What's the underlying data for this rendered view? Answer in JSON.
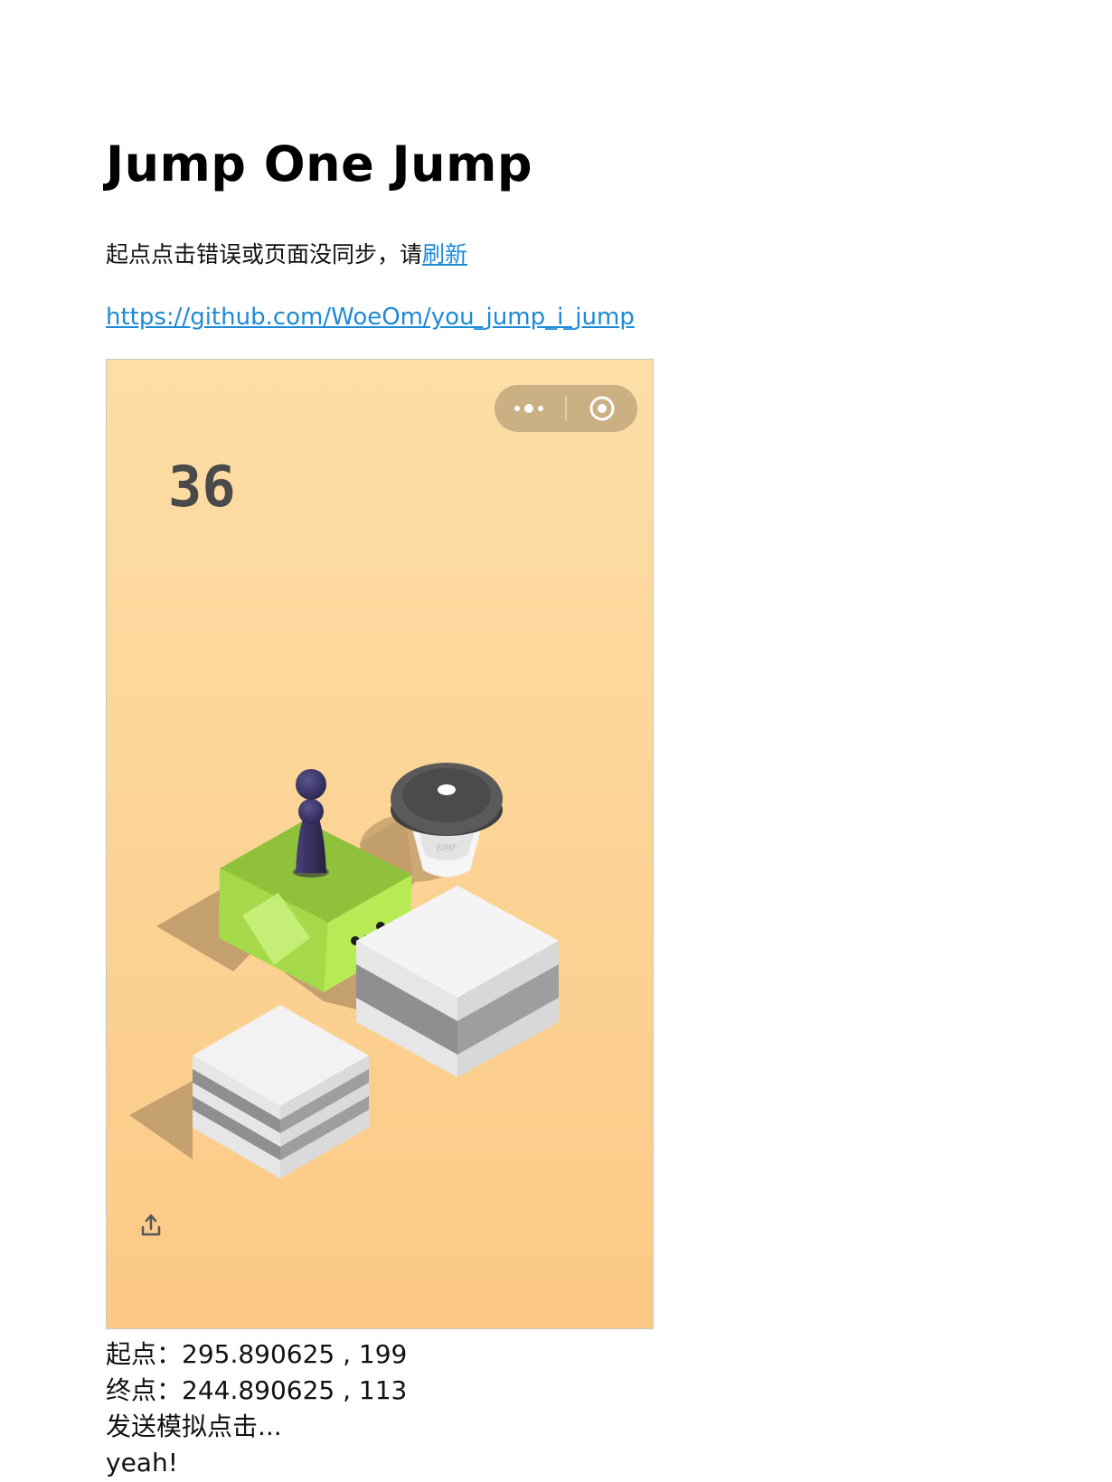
{
  "page": {
    "title": "Jump One Jump",
    "hint_text": "起点点击错误或页面没同步，请",
    "refresh_link": "刷新",
    "repo_link": "https://github.com/WoeOm/you_jump_i_jump"
  },
  "game": {
    "score": "36",
    "capsule_icons": [
      "more-icon",
      "target-icon"
    ],
    "share_icon": "share-icon",
    "cup_brand": "JUMP",
    "colors": {
      "bg_top": "#fddea7",
      "bg_bottom": "#fcc985",
      "green_block": "#b5e852",
      "piece": "#3a3460",
      "cup_lid": "#555555"
    }
  },
  "log": [
    "起点：295.890625 , 199",
    "终点：244.890625 , 113",
    "发送模拟点击...",
    "yeah!"
  ]
}
